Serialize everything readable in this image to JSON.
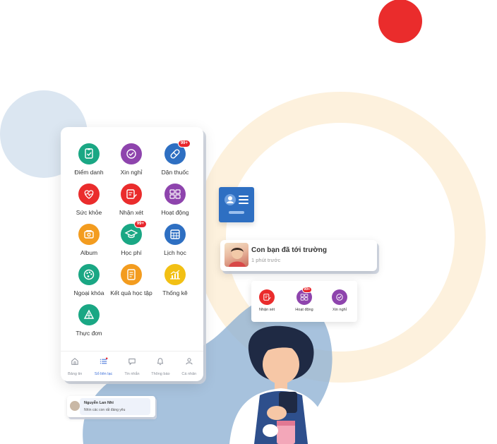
{
  "colors": {
    "red": "#ea2c2c",
    "blue": "#2e6fc2",
    "purple": "#8e44ad",
    "green": "#1aa784",
    "orange": "#f39c1f",
    "yellow": "#f2c014",
    "ring": "#fdf1dd",
    "lightblue": "#dbe6f1"
  },
  "menu": {
    "items": [
      {
        "label": "Điểm danh",
        "icon": "clipboard-check-icon",
        "color": "#1aa784"
      },
      {
        "label": "Xin nghỉ",
        "icon": "check-circle-icon",
        "color": "#8e44ad"
      },
      {
        "label": "Dặn thuốc",
        "icon": "pill-icon",
        "color": "#2e6fc2",
        "badge": "99+"
      },
      {
        "label": "Sức khỏe",
        "icon": "heart-pulse-icon",
        "color": "#ea2c2c"
      },
      {
        "label": "Nhận xét",
        "icon": "note-edit-icon",
        "color": "#ea2c2c"
      },
      {
        "label": "Hoạt động",
        "icon": "activity-grid-icon",
        "color": "#8e44ad"
      },
      {
        "label": "Album",
        "icon": "photo-album-icon",
        "color": "#f39c1f"
      },
      {
        "label": "Học phí",
        "icon": "graduation-cap-icon",
        "color": "#1aa784",
        "badge": "99+"
      },
      {
        "label": "Lịch học",
        "icon": "calendar-icon",
        "color": "#2e6fc2"
      },
      {
        "label": "Ngoại khóa",
        "icon": "palette-icon",
        "color": "#1aa784"
      },
      {
        "label": "Kết quả học tập",
        "icon": "report-icon",
        "color": "#f39c1f"
      },
      {
        "label": "Thống kê",
        "icon": "chart-icon",
        "color": "#f2c014"
      },
      {
        "label": "Thực đơn",
        "icon": "food-icon",
        "color": "#1aa784"
      }
    ]
  },
  "tabbar": {
    "tabs": [
      {
        "label": "Bảng tin",
        "icon": "home-icon"
      },
      {
        "label": "Sổ liên lạc",
        "icon": "list-icon",
        "active": true
      },
      {
        "label": "Tin nhắn",
        "icon": "message-icon"
      },
      {
        "label": "Thông báo",
        "icon": "bell-icon"
      },
      {
        "label": "Cá nhân",
        "icon": "user-icon"
      }
    ]
  },
  "chat": {
    "name": "Nguyễn Lan Nhi",
    "message": "Nhìn các con rất đáng yêu"
  },
  "notification": {
    "title": "Con bạn đã tới trường",
    "time": "1 phút trước"
  },
  "actions": {
    "items": [
      {
        "label": "Nhận xét",
        "icon": "note-edit-icon",
        "color": "#ea2c2c"
      },
      {
        "label": "Hoạt động",
        "icon": "activity-grid-icon",
        "color": "#8e44ad",
        "badge": "99+"
      },
      {
        "label": "Xin nghỉ",
        "icon": "check-circle-icon",
        "color": "#8e44ad"
      }
    ]
  }
}
